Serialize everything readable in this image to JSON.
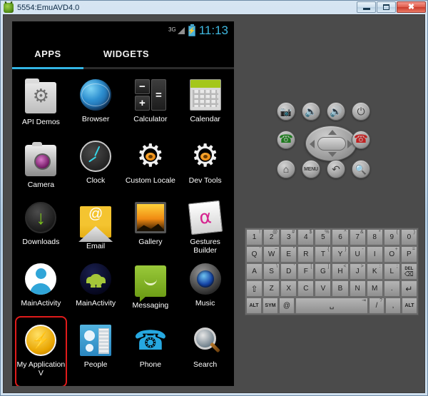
{
  "window": {
    "title": "5554:EmuAVD4.0",
    "icon": "android-head-icon",
    "buttons": {
      "minimize": "minimize-button",
      "maximize": "maximize-button",
      "close": "close-button"
    }
  },
  "statusbar": {
    "signal_label": "3G",
    "battery": "charging",
    "clock": "11:13"
  },
  "tabs": [
    {
      "label": "APPS",
      "selected": true
    },
    {
      "label": "WIDGETS",
      "selected": false
    }
  ],
  "apps": [
    {
      "label": "API Demos",
      "icon": "folder-gear-icon",
      "highlighted": false
    },
    {
      "label": "Browser",
      "icon": "globe-icon",
      "highlighted": false
    },
    {
      "label": "Calculator",
      "icon": "calculator-icon",
      "highlighted": false
    },
    {
      "label": "Calendar",
      "icon": "calendar-icon",
      "highlighted": false
    },
    {
      "label": "Camera",
      "icon": "camera-icon",
      "highlighted": false
    },
    {
      "label": "Clock",
      "icon": "clock-icon",
      "highlighted": false
    },
    {
      "label": "Custom Locale",
      "icon": "gear-icon",
      "highlighted": false
    },
    {
      "label": "Dev Tools",
      "icon": "gear-icon",
      "highlighted": false
    },
    {
      "label": "Downloads",
      "icon": "download-arrow-icon",
      "highlighted": false
    },
    {
      "label": "Email",
      "icon": "envelope-at-icon",
      "highlighted": false
    },
    {
      "label": "Gallery",
      "icon": "picture-frame-icon",
      "highlighted": false
    },
    {
      "label": "Gestures Builder",
      "icon": "gesture-pad-icon",
      "highlighted": false
    },
    {
      "label": "MainActivity",
      "icon": "person-avatar-icon",
      "highlighted": false
    },
    {
      "label": "MainActivity",
      "icon": "android-robot-icon",
      "highlighted": false
    },
    {
      "label": "Messaging",
      "icon": "speech-bubble-icon",
      "highlighted": false
    },
    {
      "label": "Music",
      "icon": "speaker-icon",
      "highlighted": false
    },
    {
      "label": "My Application V",
      "icon": "lightning-bolt-icon",
      "highlighted": true
    },
    {
      "label": "People",
      "icon": "contact-card-icon",
      "highlighted": false
    },
    {
      "label": "Phone",
      "icon": "handset-icon",
      "highlighted": false
    },
    {
      "label": "Search",
      "icon": "magnifier-icon",
      "highlighted": false
    }
  ],
  "hardware_buttons": {
    "row1": [
      {
        "name": "camera-button",
        "glyph": "■"
      },
      {
        "name": "volume-down-button",
        "glyph": "🔈"
      },
      {
        "name": "volume-up-button",
        "glyph": "🔊"
      },
      {
        "name": "power-button",
        "glyph": "⏻"
      }
    ],
    "row2": [
      {
        "name": "call-button",
        "glyph": "✆"
      },
      {
        "name": "end-call-button",
        "glyph": "✆"
      }
    ],
    "row3": [
      {
        "name": "home-button",
        "glyph": "⌂"
      },
      {
        "name": "menu-button",
        "glyph": "MENU"
      },
      {
        "name": "back-button",
        "glyph": "↶"
      },
      {
        "name": "search-button",
        "glyph": "⚲"
      }
    ],
    "dpad": {
      "up": "▲",
      "down": "▼",
      "left": "◀",
      "right": "▶",
      "center": "dpad-center-button"
    }
  },
  "keyboard": {
    "rows": [
      [
        {
          "main": "1",
          "sup": "!"
        },
        {
          "main": "2",
          "sup": "@"
        },
        {
          "main": "3",
          "sup": "#"
        },
        {
          "main": "4",
          "sup": "$"
        },
        {
          "main": "5",
          "sup": "%"
        },
        {
          "main": "6",
          "sup": "^"
        },
        {
          "main": "7",
          "sup": "&"
        },
        {
          "main": "8",
          "sup": "*"
        },
        {
          "main": "9",
          "sup": "("
        },
        {
          "main": "0",
          "sup": ")"
        }
      ],
      [
        {
          "main": "Q",
          "sup": "'"
        },
        {
          "main": "W",
          "sup": "~"
        },
        {
          "main": "E",
          "sup": "\""
        },
        {
          "main": "R",
          "sup": "`"
        },
        {
          "main": "T",
          "sup": "{"
        },
        {
          "main": "Y",
          "sup": "}"
        },
        {
          "main": "U",
          "sup": "-"
        },
        {
          "main": "I",
          "sup": ""
        },
        {
          "main": "O",
          "sup": "+"
        },
        {
          "main": "P",
          "sup": "="
        }
      ],
      [
        {
          "main": "A",
          "sup": ""
        },
        {
          "main": "S",
          "sup": "\\"
        },
        {
          "main": "D",
          "sup": "'"
        },
        {
          "main": "F",
          "sup": "["
        },
        {
          "main": "G",
          "sup": "]"
        },
        {
          "main": "H",
          "sup": "<"
        },
        {
          "main": "J",
          "sup": ">"
        },
        {
          "main": "K",
          "sup": ":"
        },
        {
          "main": "L",
          "sup": ";"
        },
        {
          "main": "DEL",
          "sup": ""
        }
      ],
      [
        {
          "main": "⇧",
          "sup": ""
        },
        {
          "main": "Z",
          "sup": ""
        },
        {
          "main": "X",
          "sup": ""
        },
        {
          "main": "C",
          "sup": ""
        },
        {
          "main": "V",
          "sup": ""
        },
        {
          "main": "B",
          "sup": ""
        },
        {
          "main": "N",
          "sup": ""
        },
        {
          "main": "M",
          "sup": ""
        },
        {
          "main": ".",
          "sup": ""
        },
        {
          "main": "↵",
          "sup": ""
        }
      ],
      [
        {
          "main": "ALT",
          "sup": ""
        },
        {
          "main": "SYM",
          "sup": ""
        },
        {
          "main": "@",
          "sup": ""
        },
        {
          "main": "␣",
          "sup": "⇥"
        },
        {
          "main": "/",
          "sup": "?"
        },
        {
          "main": ",",
          "sup": ""
        },
        {
          "main": "ALT",
          "sup": ""
        }
      ]
    ]
  },
  "colors": {
    "accent_blue": "#33b5e5",
    "clock_blue": "#3fb8e0",
    "highlight_red": "#e01b1b",
    "emulator_gray": "#4b4b4b",
    "screen_black": "#000000"
  }
}
